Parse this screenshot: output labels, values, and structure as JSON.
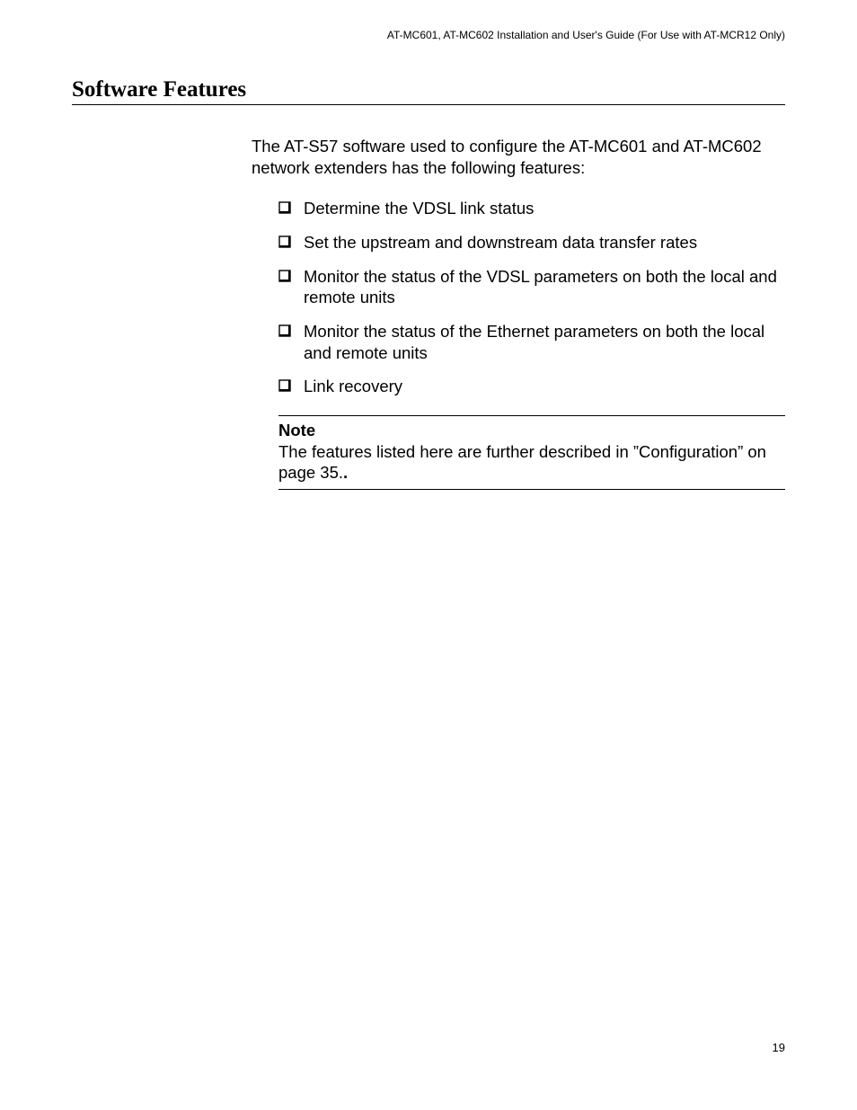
{
  "header": {
    "running_title": "AT-MC601, AT-MC602 Installation and User's Guide (For Use with AT-MCR12 Only)"
  },
  "section": {
    "title": "Software Features",
    "intro": "The AT-S57 software used to configure the AT-MC601 and AT-MC602 network extenders has the following features:",
    "features": [
      "Determine the VDSL link status",
      "Set the upstream and downstream data transfer rates",
      "Monitor the status of the VDSL parameters on both the local and remote units",
      "Monitor the status of the Ethernet parameters on both the local and remote units",
      "Link recovery"
    ],
    "note": {
      "label": "Note",
      "text": "The features listed here are further described in ”Configuration” on page 35."
    }
  },
  "page_number": "19"
}
